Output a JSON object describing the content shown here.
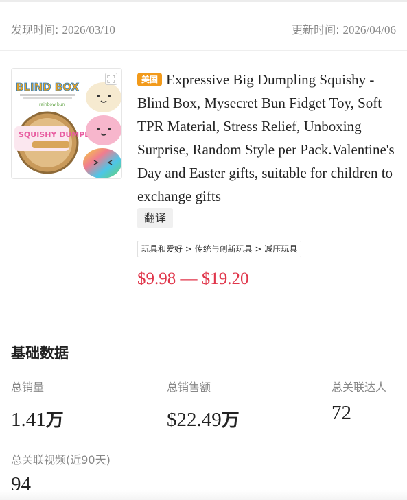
{
  "header": {
    "found_label": "发现时间: ",
    "found_date": "2026/03/10",
    "updated_label": "更新时间: ",
    "updated_date": "2026/04/06"
  },
  "product": {
    "image": {
      "icon": "blind-box-dumpling-squishy-photo",
      "logo_text": "BLIND BOX",
      "package_text": "SQUISHY DUMPLING",
      "brand_text": "rainbow bun"
    },
    "expand_icon": "expand-icon",
    "country_badge": "美国",
    "title": "Expressive Big Dumpling Squishy - Blind Box, Mysecret Bun Fidget Toy, Soft TPR Material, Stress Relief, Unboxing Surprise, Random Style per Pack.Valentine's Day and Easter gifts, suitable for children to exchange gifts",
    "translate_label": "翻译",
    "category_path": "玩具和爱好 > 传统与创新玩具 > 减压玩具",
    "price_range": "$9.98 — $19.20",
    "price_color": "#e0354a",
    "badge_color": "#f29a1a"
  },
  "basic_data": {
    "title": "基础数据",
    "stats": [
      {
        "label": "总销量",
        "value": "1.41",
        "unit": "万"
      },
      {
        "label": "总销售额",
        "value": "$22.49",
        "unit": "万"
      },
      {
        "label": "总关联达人",
        "value": "72",
        "unit": ""
      },
      {
        "label": "总关联视频(近90天)",
        "value": "94",
        "unit": ""
      }
    ]
  }
}
